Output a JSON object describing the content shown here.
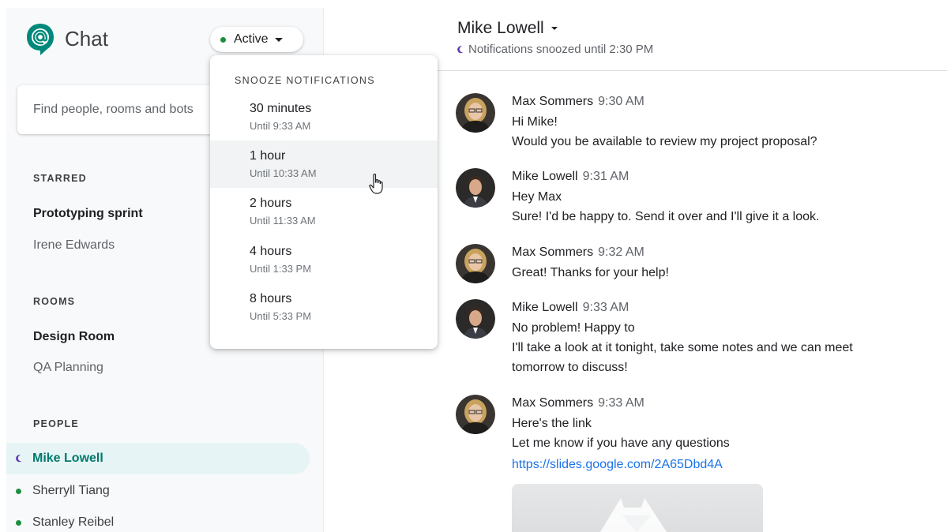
{
  "app": {
    "title": "Chat"
  },
  "status": {
    "label": "Active",
    "color": "#1e8e3e"
  },
  "search": {
    "placeholder": "Find people, rooms and bots"
  },
  "sidebar": {
    "starred": {
      "heading": "STARRED",
      "items": [
        "Prototyping sprint",
        "Irene Edwards"
      ]
    },
    "rooms": {
      "heading": "ROOMS",
      "items": [
        "Design Room",
        "QA Planning"
      ]
    },
    "people": {
      "heading": "PEOPLE",
      "items": [
        {
          "name": "Mike Lowell",
          "status": "snoozed",
          "selected": true
        },
        {
          "name": "Sherryll Tiang",
          "status": "active"
        },
        {
          "name": "Stanley Reibel",
          "status": "active"
        }
      ]
    }
  },
  "snooze_menu": {
    "heading": "SNOOZE NOTIFICATIONS",
    "options": [
      {
        "label": "30 minutes",
        "until": "Until 9:33 AM"
      },
      {
        "label": "1 hour",
        "until": "Until 10:33 AM",
        "hovered": true
      },
      {
        "label": "2 hours",
        "until": "Until 11:33 AM"
      },
      {
        "label": "4 hours",
        "until": "Until 1:33 PM"
      },
      {
        "label": "8 hours",
        "until": "Until 5:33 PM"
      }
    ]
  },
  "conversation": {
    "title": "Mike Lowell",
    "subtitle": "Notifications snoozed until 2:30 PM",
    "messages": [
      {
        "author": "Max Sommers",
        "time": "9:30 AM",
        "avatar": "max-avatar",
        "lines": [
          "Hi Mike!",
          "Would you be available to review my project proposal?"
        ]
      },
      {
        "author": "Mike Lowell",
        "time": "9:31 AM",
        "avatar": "mike-avatar",
        "lines": [
          "Hey Max",
          "Sure! I'd be happy to. Send it over and I'll give it a look."
        ]
      },
      {
        "author": "Max Sommers",
        "time": "9:32 AM",
        "avatar": "max-avatar",
        "lines": [
          "Great! Thanks for your help!"
        ]
      },
      {
        "author": "Mike Lowell",
        "time": "9:33 AM",
        "avatar": "mike-avatar",
        "lines": [
          "No problem! Happy to",
          "I'll take a look at it tonight, take some notes and we can meet",
          "tomorrow to discuss!"
        ]
      },
      {
        "author": "Max Sommers",
        "time": "9:33 AM",
        "avatar": "max-avatar",
        "lines": [
          "Here's the link",
          "Let me know if you have any questions"
        ],
        "link": "https://slides.google.com/2A65Dbd4A"
      }
    ]
  },
  "colors": {
    "accent": "#00796b",
    "selected_bg": "#e6f4f5",
    "link": "#1a73e8",
    "snooze_moon": "#5e35b1"
  }
}
